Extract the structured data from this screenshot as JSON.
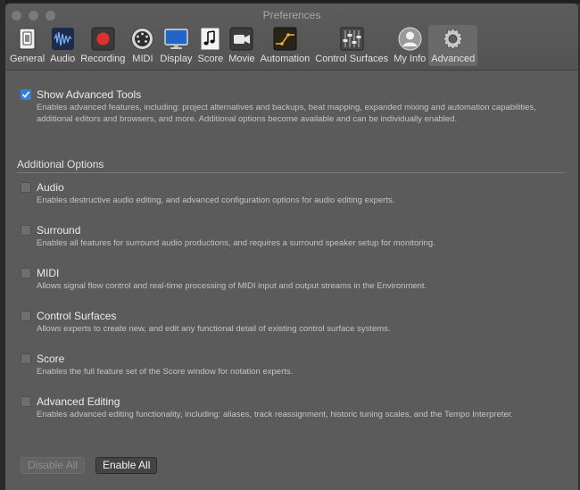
{
  "window": {
    "title": "Preferences"
  },
  "toolbar": {
    "items": [
      {
        "label": "General",
        "icon": "general-icon"
      },
      {
        "label": "Audio",
        "icon": "audio-waveform-icon"
      },
      {
        "label": "Recording",
        "icon": "record-icon"
      },
      {
        "label": "MIDI",
        "icon": "midi-port-icon"
      },
      {
        "label": "Display",
        "icon": "display-monitor-icon"
      },
      {
        "label": "Score",
        "icon": "score-note-icon"
      },
      {
        "label": "Movie",
        "icon": "movie-camera-icon"
      },
      {
        "label": "Automation",
        "icon": "automation-curve-icon"
      },
      {
        "label": "Control Surfaces",
        "icon": "faders-icon"
      },
      {
        "label": "My Info",
        "icon": "user-silhouette-icon"
      },
      {
        "label": "Advanced",
        "icon": "gear-icon"
      }
    ]
  },
  "main": {
    "show_advanced": {
      "label": "Show Advanced Tools",
      "checked": true,
      "description": "Enables advanced features, including: project alternatives and backups, beat mapping, expanded mixing and automation capabilities, additional editors and browsers, and more. Additional options become available and can be individually enabled."
    },
    "section_header": "Additional Options",
    "options": [
      {
        "label": "Audio",
        "checked": false,
        "description": "Enables destructive audio editing, and advanced configuration options for audio editing experts."
      },
      {
        "label": "Surround",
        "checked": false,
        "description": "Enables all features for surround audio productions, and requires a surround speaker setup for monitoring."
      },
      {
        "label": "MIDI",
        "checked": false,
        "description": "Allows signal flow control and real-time processing of MIDI input and output streams in the Environment."
      },
      {
        "label": "Control Surfaces",
        "checked": false,
        "description": "Allows experts to create new, and edit any functional detail of existing control surface systems."
      },
      {
        "label": "Score",
        "checked": false,
        "description": "Enables the full feature set of the Score window for notation experts."
      },
      {
        "label": "Advanced Editing",
        "checked": false,
        "description": "Enables advanced editing functionality, including: aliases, track reassignment, historic tuning scales, and the Tempo Interpreter."
      }
    ],
    "buttons": {
      "disable_all": "Disable All",
      "enable_all": "Enable All"
    }
  },
  "colors": {
    "accent": "#2f80e6",
    "background": "#5b5b5b",
    "record": "#e03030"
  }
}
